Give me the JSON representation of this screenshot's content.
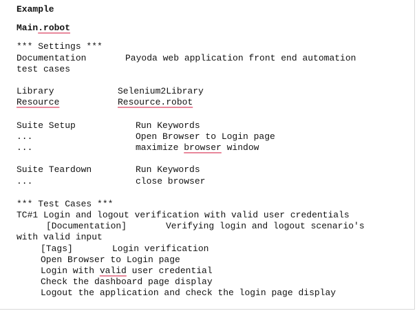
{
  "heading": "Example",
  "filename": {
    "part1": "Main",
    "part2": ".robot"
  },
  "settings": {
    "header": "*** Settings ***",
    "documentation_label": "Documentation",
    "documentation_value_1": "Payoda web application front end automation",
    "documentation_value_2": "test cases",
    "library_label": "Library",
    "library_value": "Selenium2Library",
    "resource_label": "Resource",
    "resource_value_1": "Resource",
    "resource_value_2": ".robot",
    "suite_setup_label": "Suite Setup",
    "suite_setup_value": "Run Keywords",
    "continuation": "...",
    "setup_step_1": "Open Browser to Login page",
    "setup_step_2_a": "maximize ",
    "setup_step_2_b": "browser",
    "setup_step_2_c": " window",
    "suite_teardown_label": "Suite Teardown",
    "suite_teardown_value": "Run Keywords",
    "teardown_step_1": "close browser"
  },
  "test_cases": {
    "header": "*** Test Cases ***",
    "tc_title": "TC#1 Login and logout verification with valid user credentials",
    "tc_doc_label": "[Documentation]",
    "tc_doc_value": "Verifying login and logout scenario's",
    "tc_doc_value_cont": "with valid input",
    "tc_tags_label": "[Tags]",
    "tc_tags_value": "Login verification",
    "step_1": "Open Browser to Login page",
    "step_2_a": "Login with ",
    "step_2_b": "valid",
    "step_2_c": " user credential",
    "step_3": "Check the dashboard page display",
    "step_4": "Logout the application and check the login page display"
  }
}
